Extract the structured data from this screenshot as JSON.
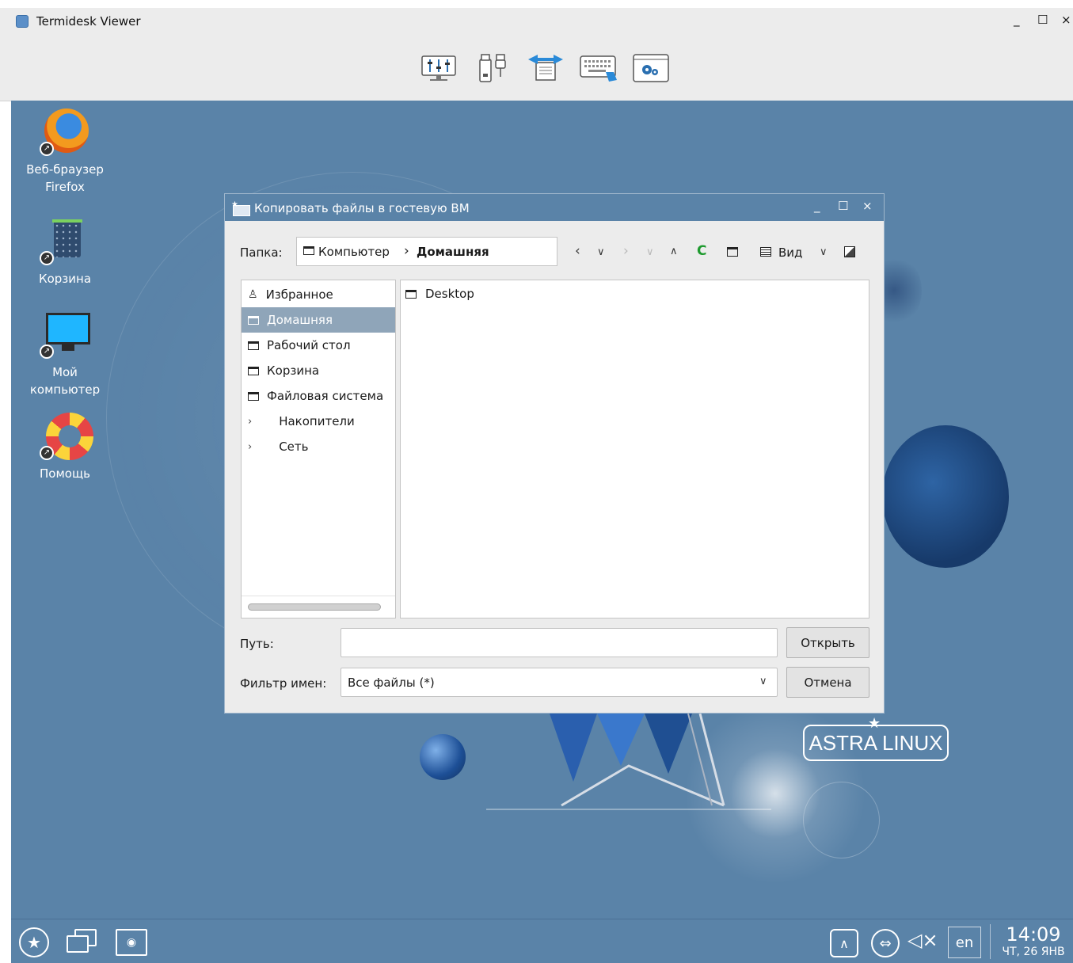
{
  "viewer": {
    "title": "Termidesk Viewer",
    "controls": {
      "minimize": "_",
      "maximize": "☐",
      "close": "×"
    },
    "toolbar": {
      "icons": [
        "settings-sliders-icon",
        "usb-devices-icon",
        "file-transfer-icon",
        "keyboard-icon",
        "preferences-icon"
      ]
    }
  },
  "desktop": {
    "icons": [
      {
        "label_line1": "Веб-браузер",
        "label_line2": "Firefox",
        "icon": "firefox-icon"
      },
      {
        "label_line1": "Корзина",
        "label_line2": "",
        "icon": "trash-icon"
      },
      {
        "label_line1": "Мой",
        "label_line2": "компьютер",
        "icon": "computer-icon"
      },
      {
        "label_line1": "Помощь",
        "label_line2": "",
        "icon": "lifebuoy-icon"
      }
    ],
    "watermark": "ASTRA LINUX"
  },
  "dialog": {
    "title": "Копировать файлы в гостевую ВМ",
    "controls": {
      "minimize": "_",
      "maximize": "☐",
      "close": "×"
    },
    "folder_label": "Папка:",
    "breadcrumb": {
      "root": "Компьютер",
      "separator": "›",
      "current": "Домашняя"
    },
    "view_label": "Вид",
    "places": [
      {
        "label": "Избранное",
        "icon": "person-icon",
        "selected": false
      },
      {
        "label": "Домашняя",
        "icon": "folder-icon",
        "selected": true
      },
      {
        "label": "Рабочий стол",
        "icon": "folder-icon",
        "selected": false
      },
      {
        "label": "Корзина",
        "icon": "folder-icon",
        "selected": false
      },
      {
        "label": "Файловая система",
        "icon": "folder-icon",
        "selected": false
      },
      {
        "label": "Накопители",
        "icon": "expand-icon",
        "selected": false
      },
      {
        "label": "Сеть",
        "icon": "expand-icon",
        "selected": false
      }
    ],
    "files": [
      {
        "name": "Desktop",
        "icon": "folder-icon"
      }
    ],
    "path_label": "Путь:",
    "path_value": "",
    "open_button": "Открыть",
    "filter_label": "Фильтр имен:",
    "filter_value": "Все файлы (*)",
    "cancel_button": "Отмена"
  },
  "taskbar": {
    "keyboard_layout": "en",
    "time": "14:09",
    "date": "ЧТ, 26 ЯНВ"
  },
  "colors": {
    "desktop_bg": "#5a83a8",
    "dialog_title_bg": "#5a83a8",
    "selection_bg": "#8fa5b9",
    "window_bg": "#ececec"
  }
}
